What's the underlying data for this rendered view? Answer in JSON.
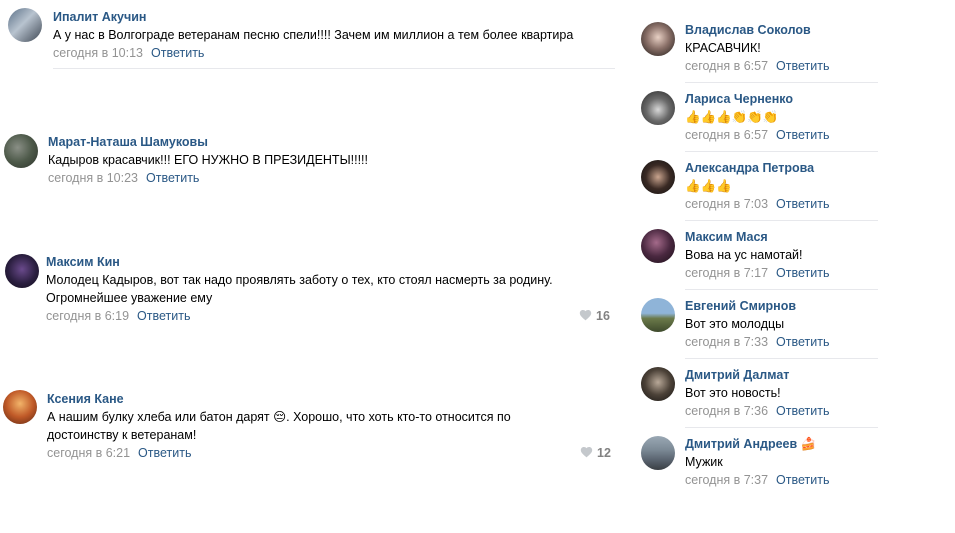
{
  "reply_label": "Ответить",
  "left_comments": [
    {
      "name": "Ипалит Акучин",
      "text": "А у нас в Волгограде ветеранам песню спели!!!! Зачем им миллион а тем более квартира",
      "time": "сегодня в 10:13",
      "likes": ""
    },
    {
      "name": "Марат-Наташа Шамуковы",
      "text": "Кадыров красавчик!!! ЕГО НУЖНО В ПРЕЗИДЕНТЫ!!!!!",
      "time": "сегодня в 10:23",
      "likes": ""
    },
    {
      "name": "Максим Кин",
      "text": "Молодец Кадыров, вот так надо проявлять заботу о тех, кто стоял насмерть за родину. Огромнейшее уважение ему",
      "time": "сегодня в 6:19",
      "likes": "16"
    },
    {
      "name": "Ксения Кане",
      "text": "А нашим булку хлеба или батон дарят 😔. Хорошо, что хоть кто-то относится по достоинству к ветеранам!",
      "time": "сегодня в 6:21",
      "likes": "12"
    }
  ],
  "right_comments": [
    {
      "name": "Владислав Соколов",
      "text": "КРАСАВЧИК!",
      "time": "сегодня в 6:57"
    },
    {
      "name": "Лариса Черненко",
      "text": "👍👍👍👏👏👏",
      "time": "сегодня в 6:57"
    },
    {
      "name": "Александра Петрова",
      "text": "👍👍👍",
      "time": "сегодня в 7:03"
    },
    {
      "name": "Максим Мася",
      "text": "Вова на ус намотай!",
      "time": "сегодня в 7:17"
    },
    {
      "name": "Евгений Смирнов",
      "text": "Вот это молодцы",
      "time": "сегодня в 7:33"
    },
    {
      "name": "Дмитрий Далмат",
      "text": "Вот это новость!",
      "time": "сегодня в 7:36"
    },
    {
      "name": "Дмитрий Андреев 🍰",
      "text": "Мужик",
      "time": "сегодня в 7:37"
    }
  ],
  "colors": {
    "link": "#2a5885",
    "meta": "#939393",
    "divider": "#e7e8ec",
    "likes": "#828282"
  },
  "icons": {
    "like": "heart-icon"
  }
}
